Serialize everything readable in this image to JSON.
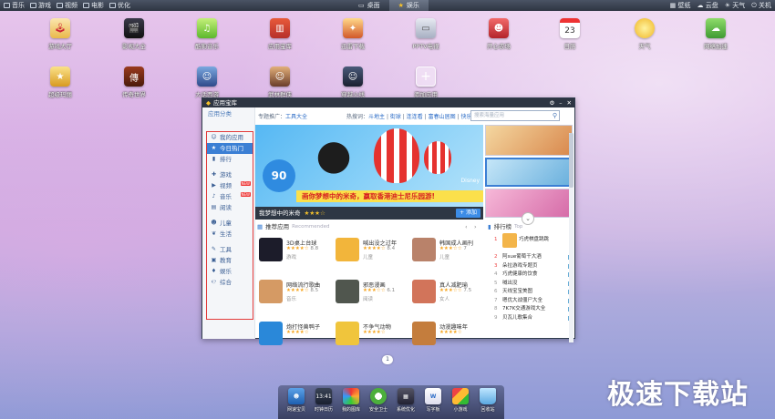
{
  "topbar": {
    "left": [
      "音乐",
      "游戏",
      "视频",
      "电影",
      "优化"
    ],
    "tabs": [
      {
        "label": "桌面",
        "active": false
      },
      {
        "label": "娱乐",
        "active": true
      }
    ],
    "right": [
      "壁纸",
      "云盘",
      "天气",
      "关机"
    ]
  },
  "desktop": {
    "row1": [
      "游戏大厅",
      "影视大全",
      "酷狗音乐",
      "应用宝库",
      "迅雷下载",
      "PPTV电视",
      "开心农场",
      "日历",
      "天气",
      "网络加速"
    ],
    "row2": [
      "超级玛丽",
      "传奇世界",
      "大话西游",
      "武林群侠",
      "穿越火线",
      "添加应用"
    ],
    "calendar_day": "23"
  },
  "window": {
    "title": "应用宝库",
    "sidebar": {
      "header": "应用分类",
      "items": [
        {
          "label": "我的应用",
          "icon": "user-icon"
        },
        {
          "label": "今日热门",
          "icon": "star-icon",
          "active": true
        },
        {
          "label": "排行",
          "icon": "bar-chart-icon"
        },
        {
          "label": "游戏",
          "icon": "gamepad-icon"
        },
        {
          "label": "视频",
          "icon": "play-icon",
          "badge": "NEW"
        },
        {
          "label": "音乐",
          "icon": "music-note-icon",
          "badge": "NEW"
        },
        {
          "label": "阅读",
          "icon": "book-icon"
        },
        {
          "label": "儿童",
          "icon": "smiley-icon"
        },
        {
          "label": "生活",
          "icon": "leaf-icon"
        },
        {
          "label": "工具",
          "icon": "wrench-icon"
        },
        {
          "label": "教育",
          "icon": "graduation-icon"
        },
        {
          "label": "娱乐",
          "icon": "mic-icon"
        },
        {
          "label": "综合",
          "icon": "e-icon"
        }
      ]
    },
    "breadcrumb": {
      "prefix": "专题推广：",
      "link": "工具大全"
    },
    "hotsearch": {
      "label": "热搜词：",
      "terms": [
        "斗地主",
        "街球",
        "连连看",
        "富春山居图",
        "快乐麻将"
      ]
    },
    "search_placeholder": "搜索海量应用",
    "banner": {
      "slogan": "画你梦想中的米奇，赢取香港迪士尼乐园游!",
      "caption": "我梦想中的米奇",
      "stars": "★★★☆",
      "add_button": "+ 添加",
      "badge": "90",
      "brand": "Disney"
    },
    "recommended": {
      "title": "推荐应用",
      "subtitle": "Recommended",
      "apps": [
        {
          "name": "3D桌上台球",
          "rating": "★★★★☆",
          "score": "8.8",
          "category": "游戏",
          "color": "#1c1c2a"
        },
        {
          "name": "喊出没之过年",
          "rating": "★★★★☆",
          "score": "8.4",
          "category": "儿童",
          "color": "#f2b53b"
        },
        {
          "name": "韩国成人画刊",
          "rating": "★★★☆☆",
          "score": "7",
          "category": "儿童",
          "color": "#b9826a"
        },
        {
          "name": "网络流行歌曲",
          "rating": "★★★★☆",
          "score": "8.5",
          "category": "音乐",
          "color": "#d59a64"
        },
        {
          "name": "邪恶漫画",
          "rating": "★★★☆☆",
          "score": "6.1",
          "category": "阅读",
          "color": "#50564e"
        },
        {
          "name": "真人减肥瑜",
          "rating": "★★★☆☆",
          "score": "7.5",
          "category": "女人",
          "color": "#d2745a"
        },
        {
          "name": "炮打怪兽鸭子",
          "rating": "★★★★☆",
          "score": "",
          "category": "",
          "color": "#2a88d9"
        },
        {
          "name": "不争气动物",
          "rating": "★★★★☆",
          "score": "",
          "category": "",
          "color": "#f0c53c"
        },
        {
          "name": "动漫趣味年",
          "rating": "★★★★☆",
          "score": "",
          "category": "",
          "color": "#c47d3d"
        }
      ]
    },
    "ranking": {
      "title": "排行榜",
      "subtitle": "Top",
      "items": [
        {
          "n": "1",
          "name": "巧虎棋盘跳跳"
        },
        {
          "n": "2",
          "name": "阿sue葡萄干大酒"
        },
        {
          "n": "3",
          "name": "朵拉游戏专题页"
        },
        {
          "n": "4",
          "name": "巧虎健康的饮食"
        },
        {
          "n": "5",
          "name": "喊出没"
        },
        {
          "n": "6",
          "name": "天线宝宝美图"
        },
        {
          "n": "7",
          "name": "嗯优大战僵尸大全"
        },
        {
          "n": "8",
          "name": "7K7K交通游戏大全"
        },
        {
          "n": "9",
          "name": "贝瓦儿歌集合"
        }
      ]
    }
  },
  "pager": "1",
  "dock": [
    "网速宝贝",
    "时钟日历",
    "我的图库",
    "安全卫士",
    "系统优化",
    "写字板",
    "小游戏",
    "回收站"
  ],
  "dock_clock": "13:41",
  "watermark": "极速下载站",
  "colors": {
    "highlight": "#e23a3a",
    "accent": "#3b7fd4",
    "titlebar": "#2d3542"
  }
}
